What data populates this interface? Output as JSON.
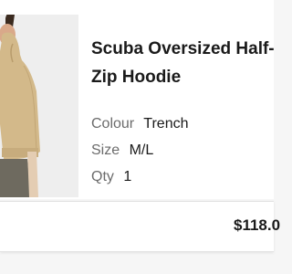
{
  "item": {
    "title_line1": "Scuba Oversized Half-",
    "title_line2": "Zip Hoodie",
    "image": "product-photo-hoodie",
    "colour": {
      "label": "Colour",
      "value": "Trench"
    },
    "size": {
      "label": "Size",
      "value": "M/L"
    },
    "qty": {
      "label": "Qty",
      "value": "1"
    },
    "price": "$118.0"
  },
  "colors": {
    "hoodie": "#d3b98a",
    "pants": "#6e6a5f",
    "background": "#f6f6f6"
  }
}
